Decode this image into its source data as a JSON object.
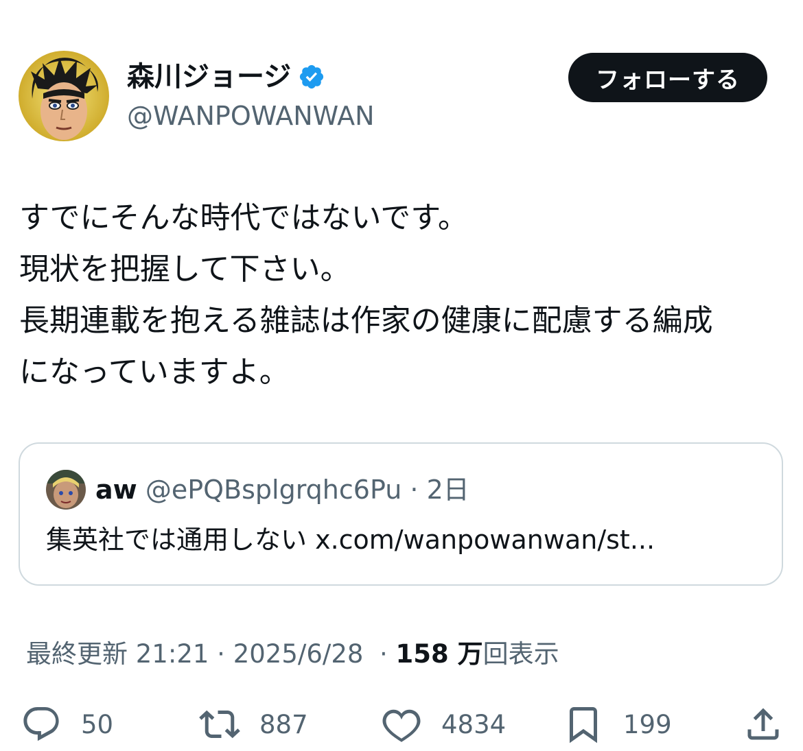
{
  "author": {
    "display_name": "森川ジョージ",
    "handle": "@WANPOWANWAN",
    "verified": true,
    "verified_color": "#1d9bf0",
    "avatar_icon": "manga-character-avatar"
  },
  "follow_button": {
    "label": "フォローする"
  },
  "tweet": {
    "lines": [
      "すでにそんな時代ではないです。",
      "現状を把握して下さい。",
      "長期連載を抱える雑誌は作家の健康に配慮する編成",
      "になっていますよ。"
    ]
  },
  "quoted_tweet": {
    "name": "aw",
    "handle": "@ePQBsplgrqhc6Pu",
    "separator": "·",
    "time": "2日",
    "text": "集英社では通用しない x.com/wanpowanwan/st..."
  },
  "meta": {
    "updated_label": "最終更新",
    "time": "21:21",
    "separator": "·",
    "date": "2025/6/28",
    "views_separator": "·",
    "views_count": "158 万",
    "views_label": "回表示"
  },
  "actions": {
    "replies": "50",
    "retweets": "887",
    "likes": "4834",
    "bookmarks": "199"
  },
  "colors": {
    "text": "#0f1419",
    "secondary": "#536471",
    "border": "#cfd9de",
    "button_bg": "#0f1419"
  }
}
